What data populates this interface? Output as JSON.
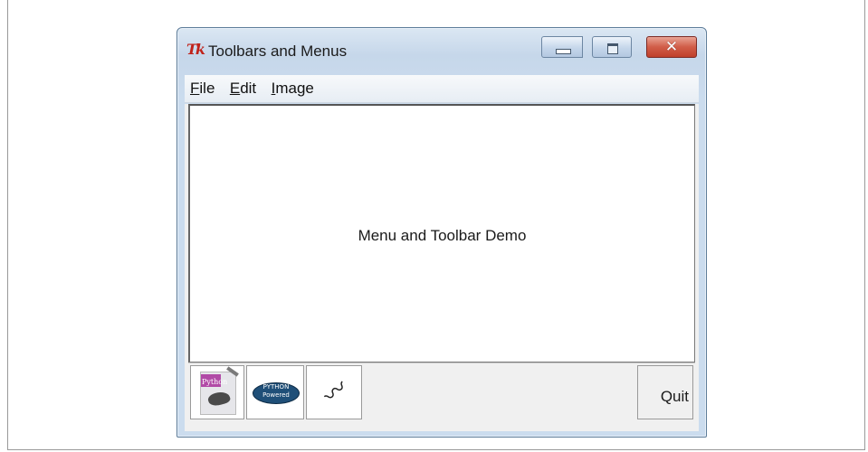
{
  "window": {
    "title": "Toolbars and Menus",
    "icon": "tk-logo-icon",
    "icon_text": "Tk",
    "controls": {
      "minimize": "minimize-icon",
      "maximize": "maximize-icon",
      "close": "close-icon",
      "close_glyph": "✕"
    }
  },
  "menubar": {
    "items": [
      {
        "label": "File",
        "mnemonic": "F",
        "rest": "ile"
      },
      {
        "label": "Edit",
        "mnemonic": "E",
        "rest": "dit"
      },
      {
        "label": "Image",
        "mnemonic": "I",
        "rest": "mage"
      }
    ]
  },
  "content": {
    "label": "Menu and Toolbar Demo"
  },
  "toolbar": {
    "buttons": [
      {
        "icon": "python-book-icon",
        "text": "Python"
      },
      {
        "icon": "python-powered-icon",
        "text_top": "PYTHON",
        "text_bottom": "Powered"
      },
      {
        "icon": "python-snake-icon"
      }
    ],
    "quit_label": "Quit"
  },
  "colors": {
    "close_button": "#c0402b",
    "tk_logo": "#c0231b"
  }
}
